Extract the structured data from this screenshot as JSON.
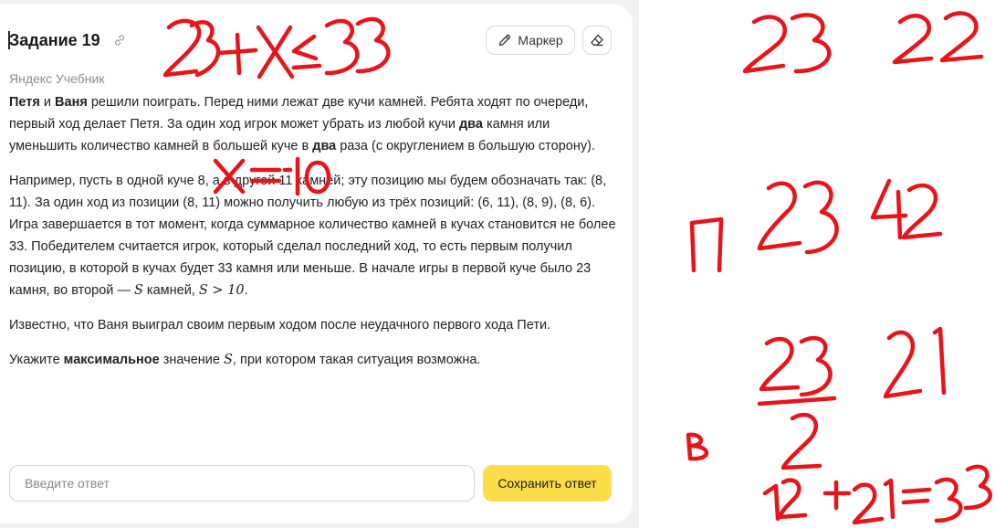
{
  "task": {
    "title": "Задание 19",
    "source": "Яндекс Учебник",
    "marker_label": "Маркер",
    "p1": {
      "n1": "Петя",
      "t1": " и ",
      "n2": "Ваня",
      "t2": " решили поиграть. Перед ними лежат две кучи камней. Ребята ходят по очереди, первый ход делает Петя. За один ход игрок может убрать из любой кучи ",
      "b1": "два",
      "t3": " камня или уменьшить количество камней в большей куче в ",
      "b2": "два",
      "t4": " раза (с округлением в большую сторону)."
    },
    "p2": {
      "t1": "Например, пусть в одной куче 8, а в другой 11 камней; эту позицию мы будем обозначать так: (8, 11). За один ход из позиции (8, 11) можно получить любую из трёх позиций: (6, 11), (8, 9), (8, 6). Игра завершается в тот момент, когда суммарное количество камней в кучах становится не более 33. Победителем считается игрок, который сделал последний ход, то есть первым получил позицию, в которой в кучах будет 33 камня или меньше. В начале игры в первой куче было 23 камня, во второй — ",
      "m1": "S",
      "t2": " камней, ",
      "m2": "S > 10",
      "t3": "."
    },
    "p3": "Известно, что Ваня выиграл своим первым ходом после неудачного первого хода Пети.",
    "p4": {
      "t1": "Укажите ",
      "b1": "максимальное",
      "t2": " значение ",
      "m1": "S",
      "t3": ", при котором такая ситуация возможна."
    },
    "answer_placeholder": "Введите ответ",
    "save_label": "Сохранить ответ"
  },
  "annotations": {
    "color": "#e8141a",
    "items": [
      "23+X≤33",
      "X=10",
      "23",
      "22",
      "П",
      "23",
      "42",
      "23",
      "21",
      "2",
      "В",
      "12+21=33"
    ]
  }
}
